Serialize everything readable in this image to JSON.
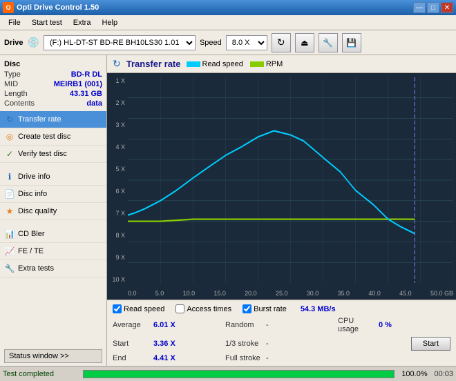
{
  "titleBar": {
    "title": "Opti Drive Control 1.50",
    "controls": [
      "—",
      "□",
      "✕"
    ]
  },
  "menuBar": {
    "items": [
      "File",
      "Start test",
      "Extra",
      "Help"
    ]
  },
  "toolbar": {
    "driveLabel": "Drive",
    "driveOption": "(F:) HL-DT-ST BD-RE BH10LS30 1.01",
    "speedLabel": "Speed",
    "speedOption": "8.0 X"
  },
  "disc": {
    "sectionTitle": "Disc",
    "rows": [
      {
        "label": "Type",
        "value": "BD-R DL"
      },
      {
        "label": "MID",
        "value": "MEIRB1 (001)"
      },
      {
        "label": "Length",
        "value": "43.31 GB"
      },
      {
        "label": "Contents",
        "value": "data"
      }
    ]
  },
  "sidebarNav": {
    "items": [
      {
        "id": "transfer-rate",
        "label": "Transfer rate",
        "active": true,
        "icon": "↻"
      },
      {
        "id": "create-test-disc",
        "label": "Create test disc",
        "active": false,
        "icon": "💿"
      },
      {
        "id": "verify-test-disc",
        "label": "Verify test disc",
        "active": false,
        "icon": "✓"
      },
      {
        "id": "drive-info",
        "label": "Drive info",
        "active": false,
        "icon": "ℹ"
      },
      {
        "id": "disc-info",
        "label": "Disc info",
        "active": false,
        "icon": "📄"
      },
      {
        "id": "disc-quality",
        "label": "Disc quality",
        "active": false,
        "icon": "★"
      },
      {
        "id": "cd-bler",
        "label": "CD Bler",
        "active": false,
        "icon": "📊"
      },
      {
        "id": "fe-te",
        "label": "FE / TE",
        "active": false,
        "icon": "📈"
      },
      {
        "id": "extra-tests",
        "label": "Extra tests",
        "active": false,
        "icon": "🔧"
      }
    ],
    "statusWindowLabel": "Status window >>",
    "dividerItems": [
      "drive-info",
      "cd-bler"
    ]
  },
  "chart": {
    "title": "Transfer rate",
    "icon": "↻",
    "legend": [
      {
        "label": "Read speed",
        "color": "#00ccff"
      },
      {
        "label": "RPM",
        "color": "#88cc00"
      }
    ],
    "yAxis": [
      "10 X",
      "9 X",
      "8 X",
      "7 X",
      "6 X",
      "5 X",
      "4 X",
      "3 X",
      "2 X",
      "1 X"
    ],
    "xAxis": [
      "0.0",
      "5.0",
      "10.0",
      "15.0",
      "20.0",
      "25.0",
      "30.0",
      "35.0",
      "40.0",
      "45.0",
      "50.0 GB"
    ]
  },
  "statsBar": {
    "checkboxes": [
      {
        "label": "Read speed",
        "checked": true
      },
      {
        "label": "Access times",
        "checked": false
      },
      {
        "label": "Burst rate",
        "checked": true
      }
    ],
    "burstRate": "54.3 MB/s",
    "stats": [
      {
        "label": "Average",
        "value": "6.01 X",
        "label2": "Random",
        "value2": "-",
        "label3": "CPU usage",
        "value3": "0 %"
      },
      {
        "label": "Start",
        "value": "3.36 X",
        "label2": "1/3 stroke",
        "value2": "-",
        "label3": "",
        "value3": ""
      },
      {
        "label": "End",
        "value": "4.41 X",
        "label2": "Full stroke",
        "value2": "-",
        "label3": "",
        "value3": ""
      }
    ],
    "startButton": "Start"
  },
  "statusBar": {
    "text": "Test completed",
    "progressPercent": 100,
    "progressDisplay": "100.0%",
    "time": "00:03"
  }
}
